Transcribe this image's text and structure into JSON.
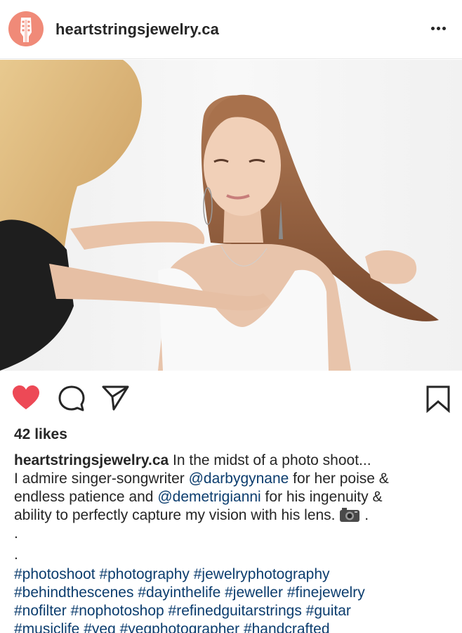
{
  "post": {
    "username": "heartstringsjewelry.ca",
    "likes": "42 likes"
  },
  "caption": {
    "username": "heartstringsjewelry.ca",
    "l1_text": " In the midst of a photo shoot...",
    "l2_a": "I admire singer-songwriter ",
    "l2_mention": "@darbygynane",
    "l2_b": " for her poise &",
    "l3_a": "endless patience and ",
    "l3_mention": "@demetrigianni",
    "l3_b": " for his ingenuity &",
    "l4_a": "ability to perfectly capture my vision with his lens. ",
    "l4_b": " .",
    "dot1": ".",
    "dot2": ".",
    "tags_l1": [
      "#photoshoot",
      "#photography",
      "#jewelryphotography"
    ],
    "tags_l2": [
      "#behindthescenes",
      "#dayinthelife",
      "#jeweller",
      "#finejewelry"
    ],
    "tags_l3": [
      "#nofilter",
      "#nophotoshop",
      "#refinedguitarstrings",
      "#guitar"
    ],
    "tags_l4": [
      "#musiclife",
      "#yeg",
      "#yegphotographer",
      "#handcrafted"
    ]
  },
  "icons": {
    "avatar": "guitar-headstock-icon",
    "like": "heart-icon",
    "comment": "comment-bubble-icon",
    "share": "paper-plane-icon",
    "save": "bookmark-icon",
    "more": "more-dots-icon"
  },
  "colors": {
    "like_red": "#ed4956",
    "link_blue": "#0c3d6e",
    "avatar_coral": "#f08a78"
  }
}
